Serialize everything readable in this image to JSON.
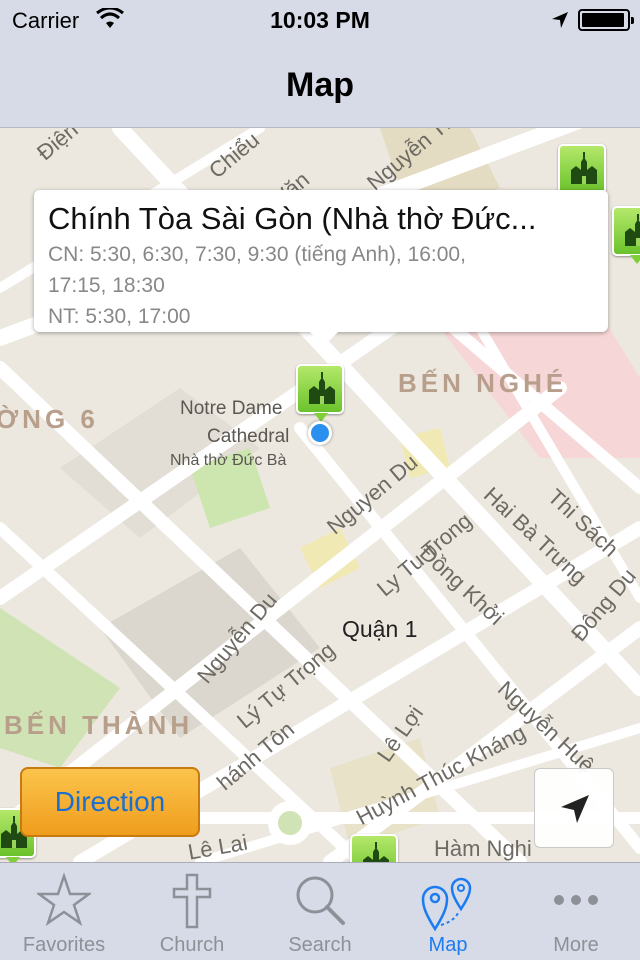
{
  "status_bar": {
    "carrier": "Carrier",
    "time": "10:03 PM",
    "battery_level": 0.95,
    "icons": [
      "wifi-icon",
      "location-arrow-icon",
      "battery-icon"
    ]
  },
  "nav_bar": {
    "title": "Map"
  },
  "map": {
    "streets": [
      "Điện",
      "Chiểu",
      "Văn",
      "Nguyễn Th",
      "Nguyen Du",
      "Ly Tu Trong",
      "Đồng Khởi",
      "Hai Bà Trưng",
      "Thi Sách",
      "Đông Du",
      "Nguyễn Du",
      "Lý Tự Trọng",
      "Lê Lợi",
      "Nguyễn Huệ",
      "Huỳnh Thúc Kháng",
      "Hàm Nghi",
      "Lê Lai",
      "hánh Tôn"
    ],
    "districts": [
      "BẾN NGHÉ",
      "ỜNG 6",
      "BẾN THÀNH"
    ],
    "poi": {
      "line1": "Notre Dame",
      "line2": "Cathedral",
      "line3": "Nhà thờ Đức Bà"
    },
    "quan": "Quận 1",
    "pin_icon": "church-icon"
  },
  "callout": {
    "title": "Chính Tòa Sài Gòn (Nhà thờ Đức...",
    "line1": "CN:  5:30,  6:30,  7:30,  9:30 (tiếng Anh), 16:00,",
    "line2": "17:15, 18:30",
    "line3": "NT:  5:30, 17:00"
  },
  "buttons": {
    "direction": "Direction",
    "locate_icon": "location-arrow-icon"
  },
  "tabs": [
    {
      "label": "Favorites",
      "icon": "star-icon",
      "active": false
    },
    {
      "label": "Church",
      "icon": "cross-icon",
      "active": false
    },
    {
      "label": "Search",
      "icon": "search-icon",
      "active": false
    },
    {
      "label": "Map",
      "icon": "map-pins-icon",
      "active": true
    },
    {
      "label": "More",
      "icon": "more-icon",
      "active": false
    }
  ],
  "colors": {
    "bar_bg": "#d7dbe8",
    "active_tab": "#1a7cf0",
    "pin_green": "#6bc22c",
    "direction_orange": "#f09d1d"
  }
}
